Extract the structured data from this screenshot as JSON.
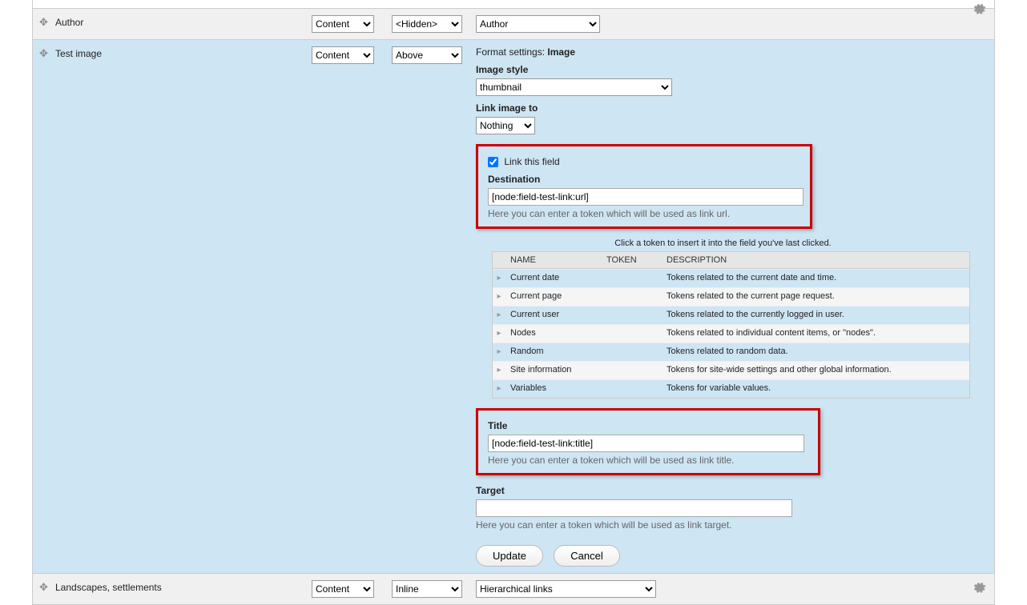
{
  "rows": {
    "clipped": {
      "text": "..."
    },
    "author": {
      "name": "Author",
      "region": "Content",
      "label": "<Hidden>",
      "format": "Author"
    },
    "testImage": {
      "name": "Test image",
      "region": "Content",
      "label": "Above",
      "format_prefix": "Format settings:",
      "format_value": "Image",
      "imageStyle": {
        "label": "Image style",
        "value": "thumbnail"
      },
      "linkImage": {
        "label": "Link image to",
        "value": "Nothing"
      },
      "linkThis": {
        "label": "Link this field",
        "checked": true
      },
      "destination": {
        "label": "Destination",
        "value": "[node:field-test-link:url]",
        "help": "Here you can enter a token which will be used as link url."
      },
      "tokenInstruction": "Click a token to insert it into the field you've last clicked.",
      "tokenHeaders": {
        "name": "NAME",
        "token": "TOKEN",
        "desc": "DESCRIPTION"
      },
      "tokens": [
        {
          "name": "Current date",
          "desc": "Tokens related to the current date and time."
        },
        {
          "name": "Current page",
          "desc": "Tokens related to the current page request."
        },
        {
          "name": "Current user",
          "desc": "Tokens related to the currently logged in user."
        },
        {
          "name": "Nodes",
          "desc": "Tokens related to individual content items, or \"nodes\"."
        },
        {
          "name": "Random",
          "desc": "Tokens related to random data."
        },
        {
          "name": "Site information",
          "desc": "Tokens for site-wide settings and other global information."
        },
        {
          "name": "Variables",
          "desc": "Tokens for variable values."
        }
      ],
      "title": {
        "label": "Title",
        "value": "[node:field-test-link:title]",
        "help": "Here you can enter a token which will be used as link title."
      },
      "target": {
        "label": "Target",
        "value": "",
        "help": "Here you can enter a token which will be used as link target."
      },
      "buttons": {
        "update": "Update",
        "cancel": "Cancel"
      }
    },
    "landscapes": {
      "name": "Landscapes, settlements",
      "region": "Content",
      "label": "Inline",
      "format": "Hierarchical links"
    }
  }
}
